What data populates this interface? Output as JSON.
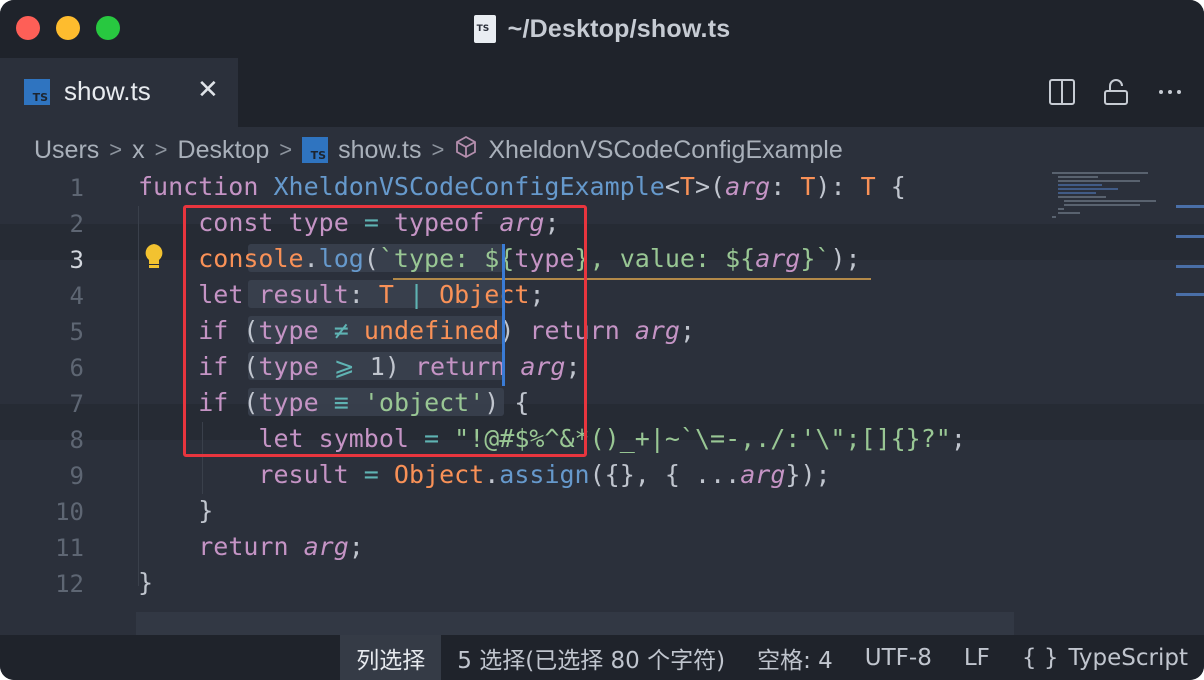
{
  "window": {
    "title": "~/Desktop/show.ts",
    "file_badge": "TS"
  },
  "tab": {
    "label": "show.ts",
    "close_glyph": "✕"
  },
  "tab_actions": [
    "split-editor-icon",
    "lock-icon",
    "more-icon"
  ],
  "breadcrumb": {
    "items": [
      "Users",
      "x",
      "Desktop",
      "show.ts",
      "XheldonVSCodeConfigExample"
    ],
    "separator": ">",
    "ts_badge": "TS"
  },
  "editor": {
    "line_numbers": [
      "1",
      "2",
      "3",
      "4",
      "5",
      "6",
      "7",
      "8",
      "9",
      "10",
      "11",
      "12"
    ],
    "active_line": "3",
    "lines": [
      "function XheldonVSCodeConfigExample<T>(arg: T): T {",
      "    const type = typeof arg;",
      "    console.log(`type: ${type}, value: ${arg}`);",
      "    let result: T | Object;",
      "    if (type ≠ undefined) return arg;",
      "    if (type ⩾ 1) return arg;",
      "    if (type ≡ 'object') {",
      "        let symbol = \"!@#$%^&*()_+|~`\\=-,./:'\\\";[]{}?\";",
      "        result = Object.assign({}, { ...arg});",
      "    }",
      "    return arg;",
      "}"
    ]
  },
  "statusbar": {
    "selection_mode": "列选择",
    "selection_info": "5 选择(已选择 80 个字符)",
    "indent": "空格: 4",
    "encoding": "UTF-8",
    "eol": "LF",
    "language_icon": "{ }",
    "language": "TypeScript"
  },
  "colors": {
    "keyword": "#c594c5",
    "function": "#6699cc",
    "type": "#f99157",
    "string": "#99c794",
    "operator": "#5fb3b3",
    "selection_box": "#e8353e",
    "cursor": "#3a7bd5"
  }
}
